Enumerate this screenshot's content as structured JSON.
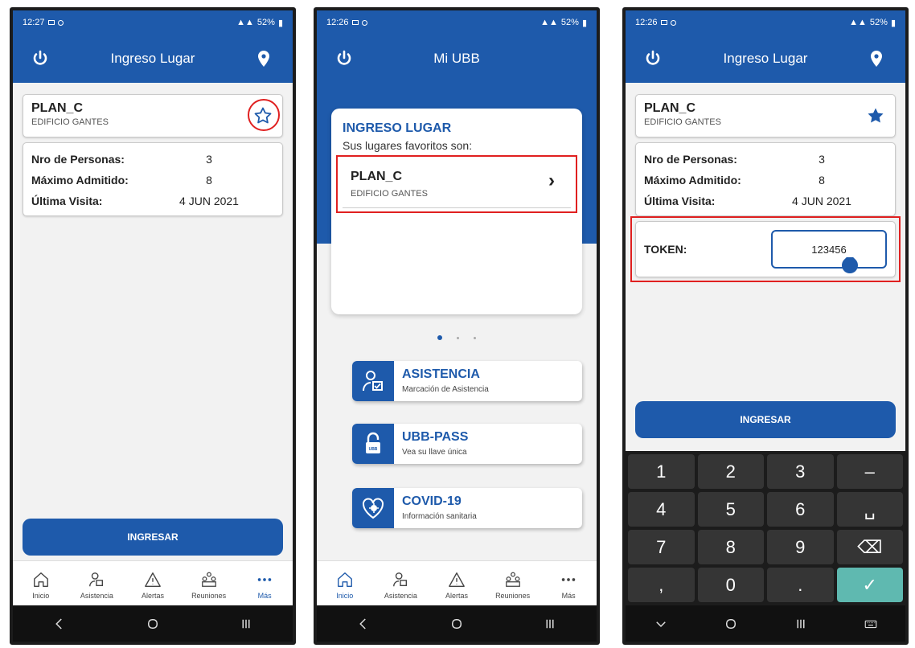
{
  "colors": {
    "primary": "#1e5aab",
    "highlight": "#e02020",
    "confirm_key": "#5fb9b0"
  },
  "screen1": {
    "status": {
      "time": "12:27",
      "battery": "52%"
    },
    "appbar": {
      "title": "Ingreso Lugar",
      "left_icon": "power-icon",
      "right_icon": "location-pin-icon"
    },
    "place": {
      "name": "PLAN_C",
      "building": "EDIFICIO GANTES",
      "favorite_icon": "star-outline-icon"
    },
    "info": [
      {
        "label": "Nro de Personas:",
        "value": "3"
      },
      {
        "label": "Máximo Admitido:",
        "value": "8"
      },
      {
        "label": "Última Visita:",
        "value": "4 JUN 2021"
      }
    ],
    "button_label": "INGRESAR",
    "nav": [
      {
        "label": "Inicio",
        "icon": "home-icon"
      },
      {
        "label": "Asistencia",
        "icon": "attendance-icon"
      },
      {
        "label": "Alertas",
        "icon": "alert-icon"
      },
      {
        "label": "Reuniones",
        "icon": "meetings-icon"
      },
      {
        "label": "Más",
        "icon": "more-icon"
      }
    ],
    "nav_active": "Más"
  },
  "screen2": {
    "status": {
      "time": "12:26",
      "battery": "52%"
    },
    "appbar": {
      "title": "Mi UBB",
      "left_icon": "power-icon"
    },
    "favorites_card": {
      "title": "INGRESO LUGAR",
      "subtitle": "Sus lugares favoritos son:",
      "place_name": "PLAN_C",
      "place_building": "EDIFICIO GANTES",
      "chevron": "›"
    },
    "carousel": {
      "pages": 3,
      "active": 0
    },
    "services": [
      {
        "title": "ASISTENCIA",
        "subtitle": "Marcación de Asistencia",
        "icon": "attendance-check-icon"
      },
      {
        "title": "UBB-PASS",
        "subtitle": "Vea su llave única",
        "icon": "padlock-icon",
        "icon_text": "UBB"
      },
      {
        "title": "COVID-19",
        "subtitle": "Información sanitaria",
        "icon": "heart-virus-icon"
      }
    ],
    "nav": [
      {
        "label": "Inicio"
      },
      {
        "label": "Asistencia"
      },
      {
        "label": "Alertas"
      },
      {
        "label": "Reuniones"
      },
      {
        "label": "Más"
      }
    ],
    "nav_active": "Inicio"
  },
  "screen3": {
    "status": {
      "time": "12:26",
      "battery": "52%"
    },
    "appbar": {
      "title": "Ingreso Lugar",
      "left_icon": "power-icon",
      "right_icon": "location-pin-icon"
    },
    "place": {
      "name": "PLAN_C",
      "building": "EDIFICIO GANTES",
      "favorite_icon": "star-filled-icon"
    },
    "info": [
      {
        "label": "Nro de Personas:",
        "value": "3"
      },
      {
        "label": "Máximo Admitido:",
        "value": "8"
      },
      {
        "label": "Última Visita:",
        "value": "4 JUN 2021"
      }
    ],
    "token": {
      "label": "TOKEN:",
      "value": "123456"
    },
    "button_label": "INGRESAR",
    "keypad": [
      "1",
      "2",
      "3",
      "–",
      "4",
      "5",
      "6",
      "␣",
      "7",
      "8",
      "9",
      "⌫",
      ",",
      "0",
      ".",
      "✓"
    ]
  }
}
